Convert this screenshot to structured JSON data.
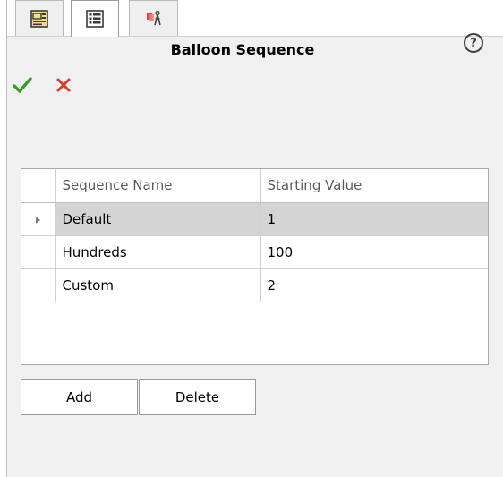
{
  "tabs": [
    {
      "icon": "property-manager-icon"
    },
    {
      "icon": "configuration-list-icon",
      "active": true
    },
    {
      "icon": "balloon-tool-icon"
    }
  ],
  "header": {
    "title": "Balloon Sequence",
    "help_label": "?"
  },
  "actions": {
    "ok_icon": "checkmark-icon",
    "cancel_icon": "close-icon",
    "ok_color": "#3a9a2a",
    "cancel_color": "#d83b2c"
  },
  "grid": {
    "columns": [
      "Sequence Name",
      "Starting Value"
    ],
    "rows": [
      {
        "name": "Default",
        "value": "1",
        "selected": true
      },
      {
        "name": "Hundreds",
        "value": "100"
      },
      {
        "name": "Custom",
        "value": "2"
      }
    ]
  },
  "buttons": {
    "add_label": "Add",
    "delete_label": "Delete"
  }
}
